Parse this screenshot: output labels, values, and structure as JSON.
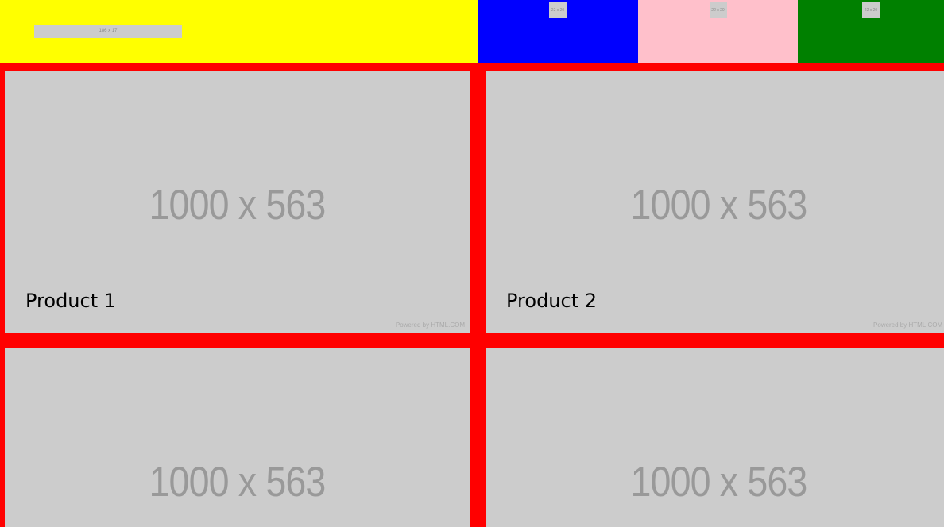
{
  "header": {
    "logo": {
      "label": "186 x 17",
      "bg": "#ffff00"
    },
    "nav": [
      {
        "label": "22 x 20",
        "bg": "#0000ff"
      },
      {
        "label": "22 x 20",
        "bg": "#ffc0cb"
      },
      {
        "label": "22 x 20",
        "bg": "#008000"
      }
    ]
  },
  "products": [
    {
      "image_label": "1000 x 563",
      "title": "Product 1",
      "powered": "Powered by HTML.COM"
    },
    {
      "image_label": "1000 x 563",
      "title": "Product 2",
      "powered": "Powered by HTML.COM"
    },
    {
      "image_label": "1000 x 563",
      "title": "",
      "powered": ""
    },
    {
      "image_label": "1000 x 563",
      "title": "",
      "powered": ""
    }
  ],
  "colors": {
    "page_background": "#ff0000",
    "placeholder": "#cccccc"
  }
}
